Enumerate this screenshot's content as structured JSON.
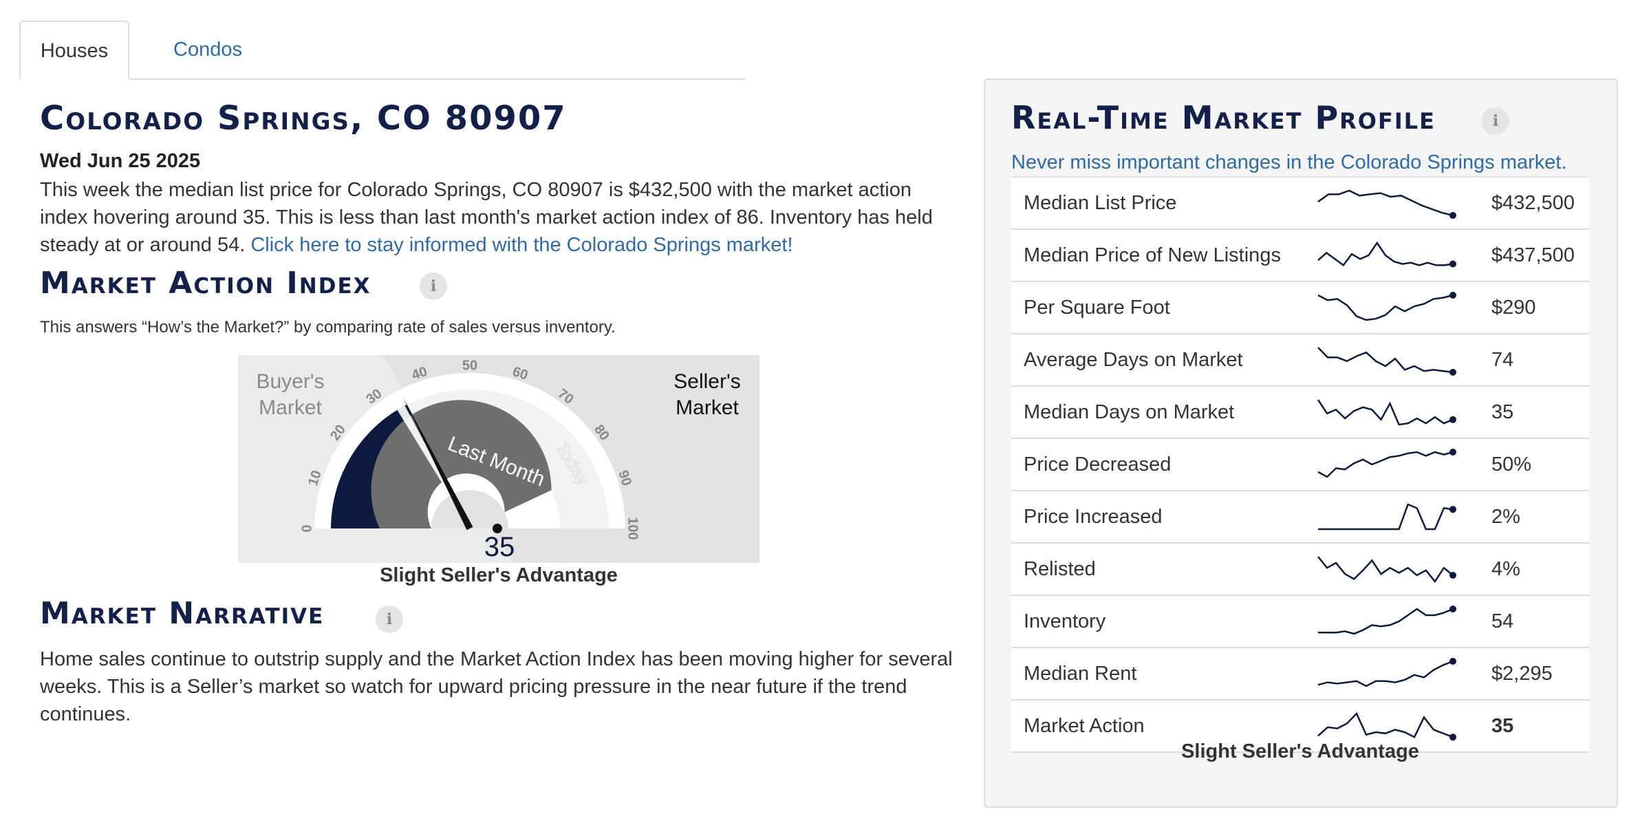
{
  "tabs": [
    {
      "label": "Houses",
      "active": true
    },
    {
      "label": "Condos",
      "active": false
    }
  ],
  "main": {
    "title": "Colorado Springs, CO 80907",
    "date": "Wed Jun 25 2025",
    "paragraph": "This week the median list price for Colorado Springs, CO 80907 is $432,500 with the market action index hovering around 35. This is less than last month's market action index of 86. Inventory has held steady at or around 54.",
    "link_text": "Click here to stay informed with the Colorado Springs market!"
  },
  "market_action": {
    "title": "Market Action Index",
    "info_icon": "info-icon",
    "description": "This answers “How’s the Market?” by comparing rate of sales versus inventory.",
    "gauge": {
      "value": 35,
      "last_month": 86,
      "buyer_label_line1": "Buyer's",
      "buyer_label_line2": "Market",
      "seller_label_line1": "Seller's",
      "seller_label_line2": "Market",
      "last_month_label": "Last Month",
      "today_label": "Today",
      "ticks": [
        "0",
        "10",
        "20",
        "30",
        "40",
        "50",
        "60",
        "70",
        "80",
        "90",
        "100"
      ],
      "colors": {
        "navy": "#0b1a3e",
        "gray": "#6f6f6f",
        "needle": "#111111"
      }
    },
    "caption": "Slight Seller's Advantage"
  },
  "narrative": {
    "title": "Market Narrative",
    "text": "Home sales continue to outstrip supply and the Market Action Index has been moving higher for several weeks. This is a Seller’s market so watch for upward pricing pressure in the near future if the trend continues."
  },
  "profile": {
    "title": "Real-Time Market Profile",
    "subtitle": "Never miss important changes in the Colorado Springs market.",
    "rows": [
      {
        "label": "Median List Price",
        "value": "$432,500",
        "bold": false,
        "trend": [
          0.55,
          0.85,
          0.85,
          1.0,
          0.8,
          0.85,
          0.9,
          0.75,
          0.8,
          0.6,
          0.4,
          0.25,
          0.1,
          0.0
        ]
      },
      {
        "label": "Median Price of New Listings",
        "value": "$437,500",
        "bold": false,
        "trend": [
          0.3,
          0.6,
          0.35,
          0.1,
          0.55,
          0.35,
          0.5,
          1.0,
          0.5,
          0.25,
          0.15,
          0.2,
          0.1,
          0.2,
          0.1,
          0.1,
          0.15
        ]
      },
      {
        "label": "Per Square Foot",
        "value": "$290",
        "bold": false,
        "trend": [
          1.0,
          0.8,
          0.85,
          0.6,
          0.15,
          0.0,
          0.05,
          0.2,
          0.55,
          0.35,
          0.55,
          0.65,
          0.85,
          0.9,
          1.0
        ]
      },
      {
        "label": "Average Days on Market",
        "value": "74",
        "bold": false,
        "trend": [
          1.0,
          0.6,
          0.6,
          0.45,
          0.65,
          0.8,
          0.45,
          0.25,
          0.55,
          0.1,
          0.25,
          0.05,
          0.1,
          0.05,
          0.0
        ]
      },
      {
        "label": "Median Days on Market",
        "value": "35",
        "bold": false,
        "trend": [
          1.0,
          0.45,
          0.6,
          0.25,
          0.55,
          0.7,
          0.6,
          0.2,
          0.85,
          0.0,
          0.05,
          0.25,
          0.05,
          0.3,
          0.05,
          0.2
        ]
      },
      {
        "label": "Price Decreased",
        "value": "50%",
        "bold": false,
        "trend": [
          0.2,
          0.0,
          0.35,
          0.3,
          0.55,
          0.7,
          0.5,
          0.65,
          0.8,
          0.85,
          0.95,
          1.0,
          0.85,
          1.0,
          0.9,
          1.0
        ]
      },
      {
        "label": "Price Increased",
        "value": "2%",
        "bold": false,
        "trend": [
          0,
          0,
          0,
          0,
          0,
          0,
          0,
          0,
          0,
          0,
          1.0,
          0.85,
          0.0,
          0.0,
          0.85,
          0.8
        ]
      },
      {
        "label": "Relisted",
        "value": "4%",
        "bold": false,
        "trend": [
          1.0,
          0.55,
          0.75,
          0.3,
          0.1,
          0.45,
          0.85,
          0.3,
          0.55,
          0.35,
          0.55,
          0.25,
          0.45,
          0.0,
          0.55,
          0.25
        ]
      },
      {
        "label": "Inventory",
        "value": "54",
        "bold": false,
        "trend": [
          0.05,
          0.05,
          0.05,
          0.1,
          0.0,
          0.15,
          0.35,
          0.3,
          0.35,
          0.5,
          0.75,
          1.0,
          0.75,
          0.75,
          0.85,
          1.0
        ]
      },
      {
        "label": "Median Rent",
        "value": "$2,295",
        "bold": false,
        "trend": [
          0.05,
          0.15,
          0.1,
          0.15,
          0.2,
          0.0,
          0.2,
          0.2,
          0.15,
          0.25,
          0.45,
          0.35,
          0.65,
          0.85,
          1.0
        ]
      },
      {
        "label": "Market Action",
        "value": "35",
        "bold": true,
        "trend": [
          0.1,
          0.45,
          0.4,
          0.6,
          1.0,
          0.15,
          0.25,
          0.2,
          0.35,
          0.25,
          0.05,
          0.85,
          0.35,
          0.2,
          0.05
        ]
      }
    ],
    "caption": "Slight Seller's Advantage"
  }
}
